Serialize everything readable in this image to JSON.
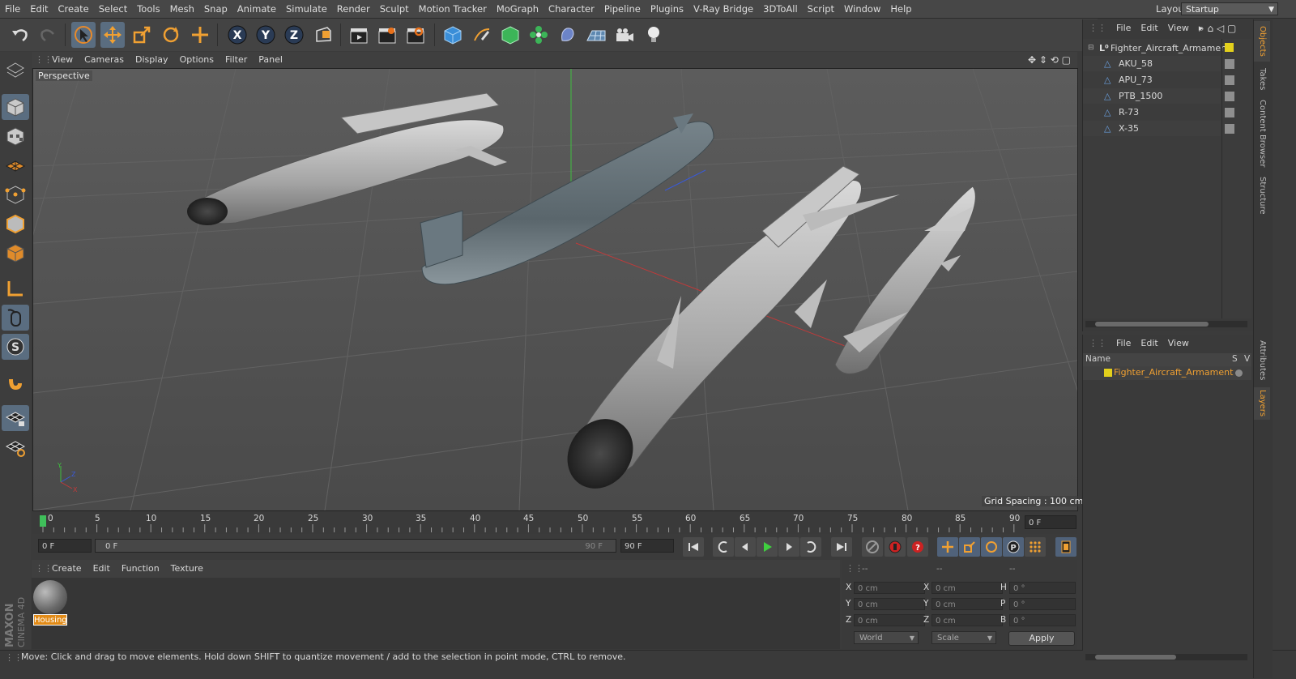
{
  "menu": [
    "File",
    "Edit",
    "Create",
    "Select",
    "Tools",
    "Mesh",
    "Snap",
    "Animate",
    "Simulate",
    "Render",
    "Sculpt",
    "Motion Tracker",
    "MoGraph",
    "Character",
    "Pipeline",
    "Plugins",
    "V-Ray Bridge",
    "3DToAll",
    "Script",
    "Window",
    "Help"
  ],
  "layout": {
    "label": "Layout:",
    "value": "Startup"
  },
  "viewport": {
    "menu": [
      "View",
      "Cameras",
      "Display",
      "Options",
      "Filter",
      "Panel"
    ],
    "camera_label": "Perspective",
    "grid_spacing": "Grid Spacing : 100 cm"
  },
  "timeline": {
    "ticks": [
      "0",
      "5",
      "10",
      "15",
      "20",
      "25",
      "30",
      "35",
      "40",
      "45",
      "50",
      "55",
      "60",
      "65",
      "70",
      "75",
      "80",
      "85",
      "90"
    ],
    "current_frame_field": "0 F",
    "start_field": "0 F",
    "range_start": "0 F",
    "range_end": "90 F",
    "end_field": "90 F"
  },
  "material_manager": {
    "menu": [
      "Create",
      "Edit",
      "Function",
      "Texture"
    ],
    "material_name": "Housing"
  },
  "coords": {
    "header": [
      "--",
      "--",
      "--"
    ],
    "rows": [
      {
        "l1": "X",
        "v1": "0 cm",
        "l2": "X",
        "v2": "0 cm",
        "l3": "H",
        "v3": "0 °"
      },
      {
        "l1": "Y",
        "v1": "0 cm",
        "l2": "Y",
        "v2": "0 cm",
        "l3": "P",
        "v3": "0 °"
      },
      {
        "l1": "Z",
        "v1": "0 cm",
        "l2": "Z",
        "v2": "0 cm",
        "l3": "B",
        "v3": "0 °"
      }
    ],
    "space": "World",
    "mode": "Scale",
    "apply": "Apply"
  },
  "status": "Move: Click and drag to move elements. Hold down SHIFT to quantize movement / add to the selection in point mode, CTRL to remove.",
  "object_manager": {
    "menu": [
      "File",
      "Edit",
      "View"
    ],
    "root": "Fighter_Aircraft_Armament",
    "children": [
      "AKU_58",
      "APU_73",
      "PTB_1500",
      "R-73",
      "X-35"
    ]
  },
  "layer_manager": {
    "menu": [
      "File",
      "Edit",
      "View"
    ],
    "col_name": "Name",
    "col_s": "S",
    "col_v": "V",
    "layer": "Fighter_Aircraft_Armament"
  },
  "side_tabs": [
    "Objects",
    "Takes",
    "Content Browser",
    "Structure",
    "Attributes",
    "Layers"
  ],
  "brand": {
    "maker": "MAXON",
    "product": "CINEMA 4D"
  },
  "colors": {
    "accent": "#f0a032",
    "layer_yellow": "#e3d01c",
    "highlight": "#5a6d80"
  }
}
